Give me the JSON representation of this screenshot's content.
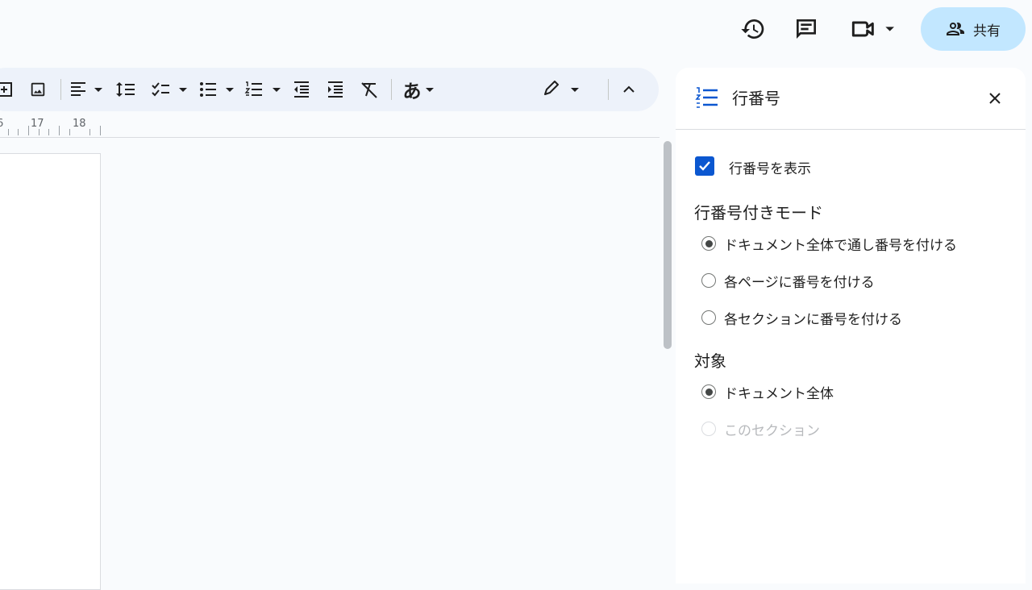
{
  "header": {
    "history_icon": "history-icon",
    "comment_icon": "comment-icon",
    "meet_icon": "video-camera-icon",
    "share_label": "共有"
  },
  "toolbar": {
    "icons": [
      "insert-icon",
      "image-icon",
      "align-left-icon",
      "line-spacing-icon",
      "checklist-icon",
      "bulleted-list-icon",
      "numbered-list-icon",
      "decrease-indent-icon",
      "increase-indent-icon",
      "clear-formatting-icon",
      "input-tools-icon",
      "editing-mode-icon",
      "collapse-menu-icon"
    ],
    "input_tool_label": "あ"
  },
  "ruler": {
    "labels": [
      "6",
      "17",
      "18"
    ]
  },
  "panel": {
    "title": "行番号",
    "show_line_numbers": {
      "label": "行番号を表示",
      "checked": true
    },
    "mode": {
      "title": "行番号付きモード",
      "options": [
        {
          "label": "ドキュメント全体で通し番号を付ける",
          "selected": true
        },
        {
          "label": "各ページに番号を付ける",
          "selected": false
        },
        {
          "label": "各セクションに番号を付ける",
          "selected": false
        }
      ]
    },
    "target": {
      "title": "対象",
      "options": [
        {
          "label": "ドキュメント全体",
          "selected": true,
          "disabled": false
        },
        {
          "label": "このセクション",
          "selected": false,
          "disabled": true
        }
      ]
    }
  },
  "colors": {
    "accent": "#0b57d0",
    "share_bg": "#c2e7ff",
    "toolbar_bg": "#edf2fa"
  }
}
